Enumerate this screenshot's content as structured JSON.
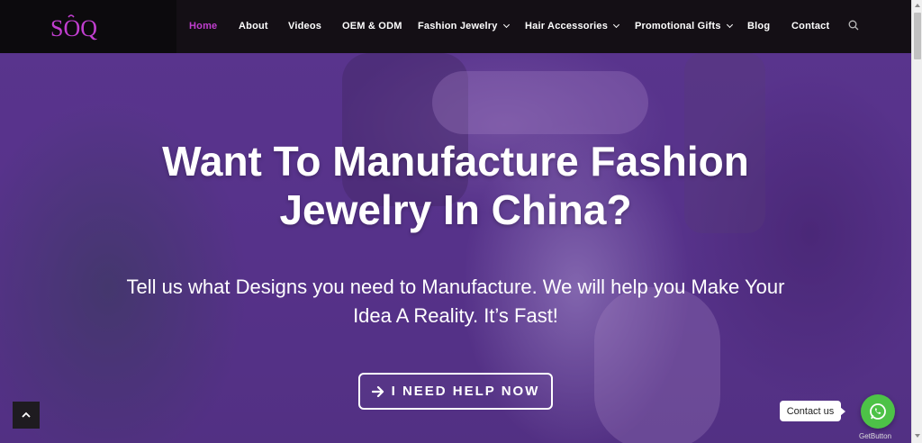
{
  "brand": {
    "logo_text": "SOQ",
    "accent_color": "#c13ecf"
  },
  "nav": {
    "items": [
      {
        "label": "Home",
        "active": true,
        "dropdown": false
      },
      {
        "label": "About",
        "active": false,
        "dropdown": false
      },
      {
        "label": "Videos",
        "active": false,
        "dropdown": false
      },
      {
        "label": "OEM & ODM",
        "active": false,
        "dropdown": false
      },
      {
        "label": "Fashion Jewelry",
        "active": false,
        "dropdown": true
      },
      {
        "label": "Hair Accessories",
        "active": false,
        "dropdown": true
      },
      {
        "label": "Promotional Gifts",
        "active": false,
        "dropdown": true
      },
      {
        "label": "Blog",
        "active": false,
        "dropdown": false
      },
      {
        "label": "Contact",
        "active": false,
        "dropdown": false
      }
    ],
    "search_icon": "search-icon"
  },
  "hero": {
    "title": "Want To Manufacture Fashion Jewelry In China?",
    "subtitle": "Tell us what Designs you need to Manufacture. We will help you Make Your Idea A Reality. It’s Fast!",
    "cta_label": "I NEED HELP NOW",
    "cta_icon": "arrow-right-icon"
  },
  "widgets": {
    "back_to_top_icon": "chevron-up-icon",
    "contact_label": "Contact us",
    "whatsapp_icon": "whatsapp-icon",
    "whatsapp_color": "#4dc247",
    "getbutton_label": "GetButton"
  }
}
